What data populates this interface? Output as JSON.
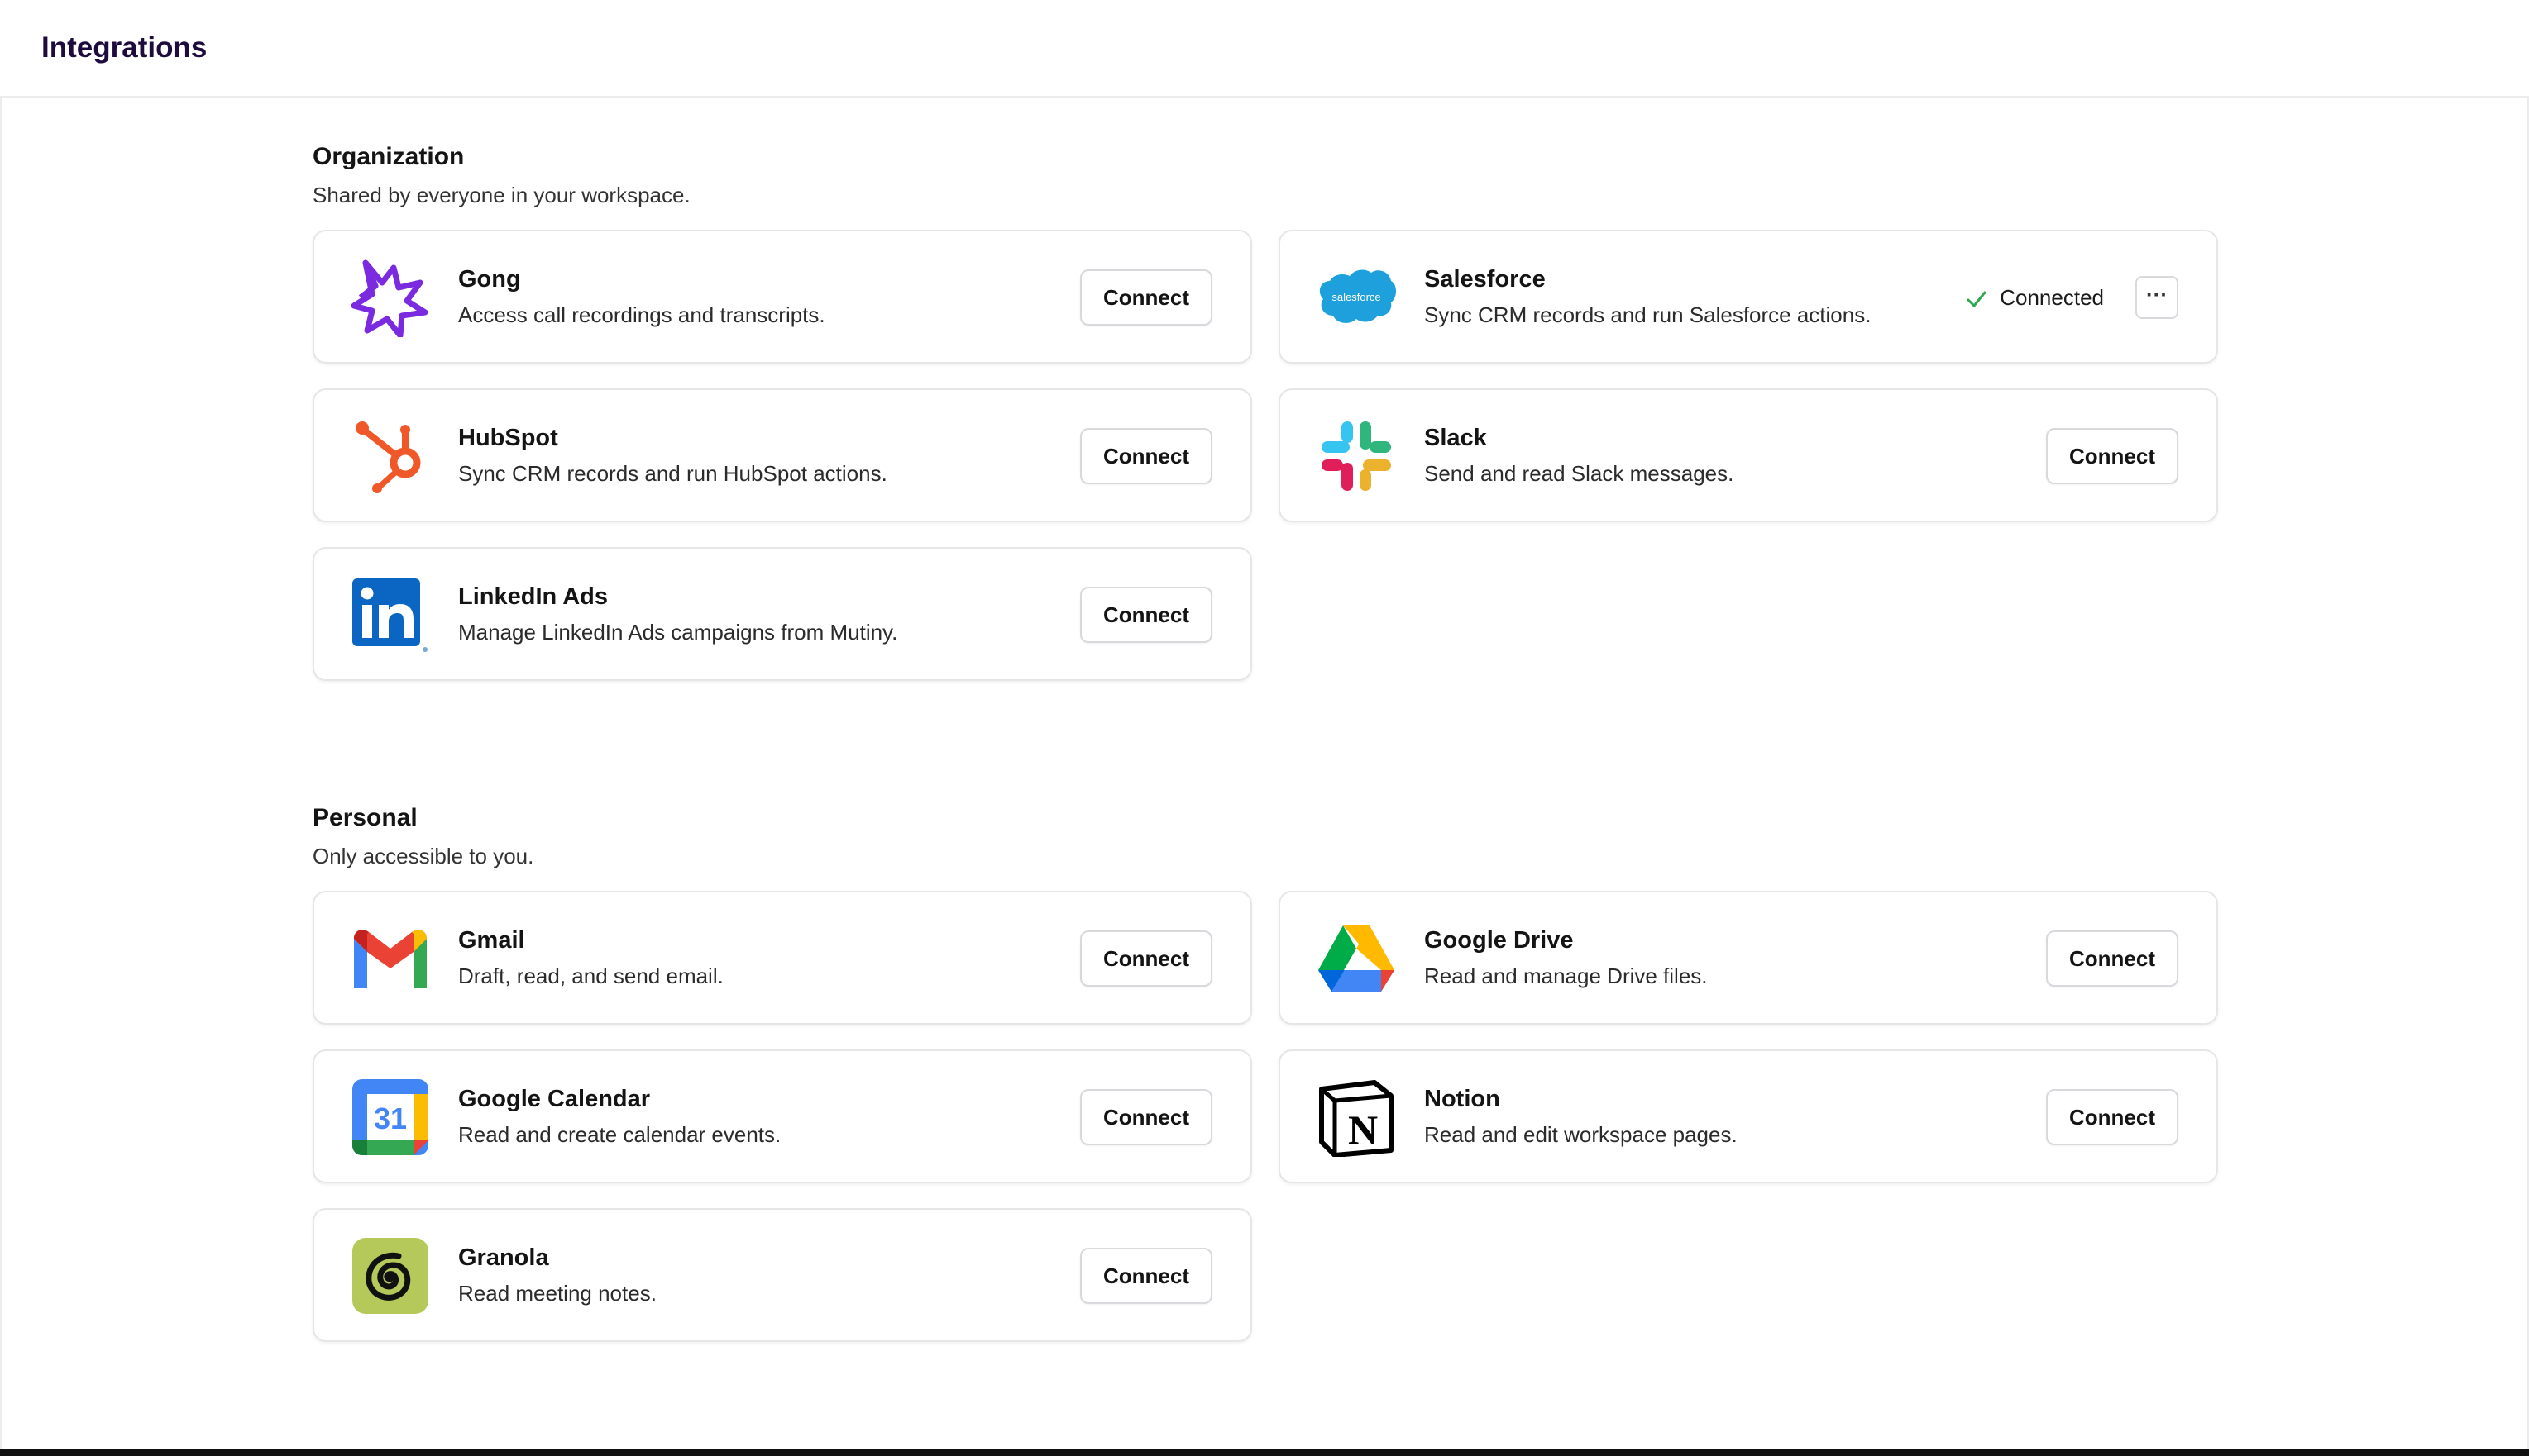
{
  "header": {
    "title": "Integrations"
  },
  "organization": {
    "title": "Organization",
    "subtitle": "Shared by everyone in your workspace.",
    "items": [
      {
        "name": "Gong",
        "description": "Access call recordings and transcripts.",
        "action": "Connect",
        "icon": "gong-icon"
      },
      {
        "name": "Salesforce",
        "description": "Sync CRM records and run Salesforce actions.",
        "status": "Connected",
        "more": "···",
        "icon": "salesforce-icon",
        "logo_text": "salesforce"
      },
      {
        "name": "HubSpot",
        "description": "Sync CRM records and run HubSpot actions.",
        "action": "Connect",
        "icon": "hubspot-icon"
      },
      {
        "name": "Slack",
        "description": "Send and read Slack messages.",
        "action": "Connect",
        "icon": "slack-icon"
      },
      {
        "name": "LinkedIn Ads",
        "description": "Manage LinkedIn Ads campaigns from Mutiny.",
        "action": "Connect",
        "icon": "linkedin-icon"
      }
    ]
  },
  "personal": {
    "title": "Personal",
    "subtitle": "Only accessible to you.",
    "items": [
      {
        "name": "Gmail",
        "description": "Draft, read, and send email.",
        "action": "Connect",
        "icon": "gmail-icon"
      },
      {
        "name": "Google Drive",
        "description": "Read and manage Drive files.",
        "action": "Connect",
        "icon": "google-drive-icon"
      },
      {
        "name": "Google Calendar",
        "description": "Read and create calendar events.",
        "action": "Connect",
        "icon": "google-calendar-icon",
        "logo_text": "31"
      },
      {
        "name": "Notion",
        "description": "Read and edit workspace pages.",
        "action": "Connect",
        "icon": "notion-icon",
        "logo_text": "N"
      },
      {
        "name": "Granola",
        "description": "Read meeting notes.",
        "action": "Connect",
        "icon": "granola-icon"
      }
    ]
  },
  "colors": {
    "title": "#1d0b3d",
    "connected_check": "#2fa84f",
    "card_border": "#e6e6e9"
  }
}
